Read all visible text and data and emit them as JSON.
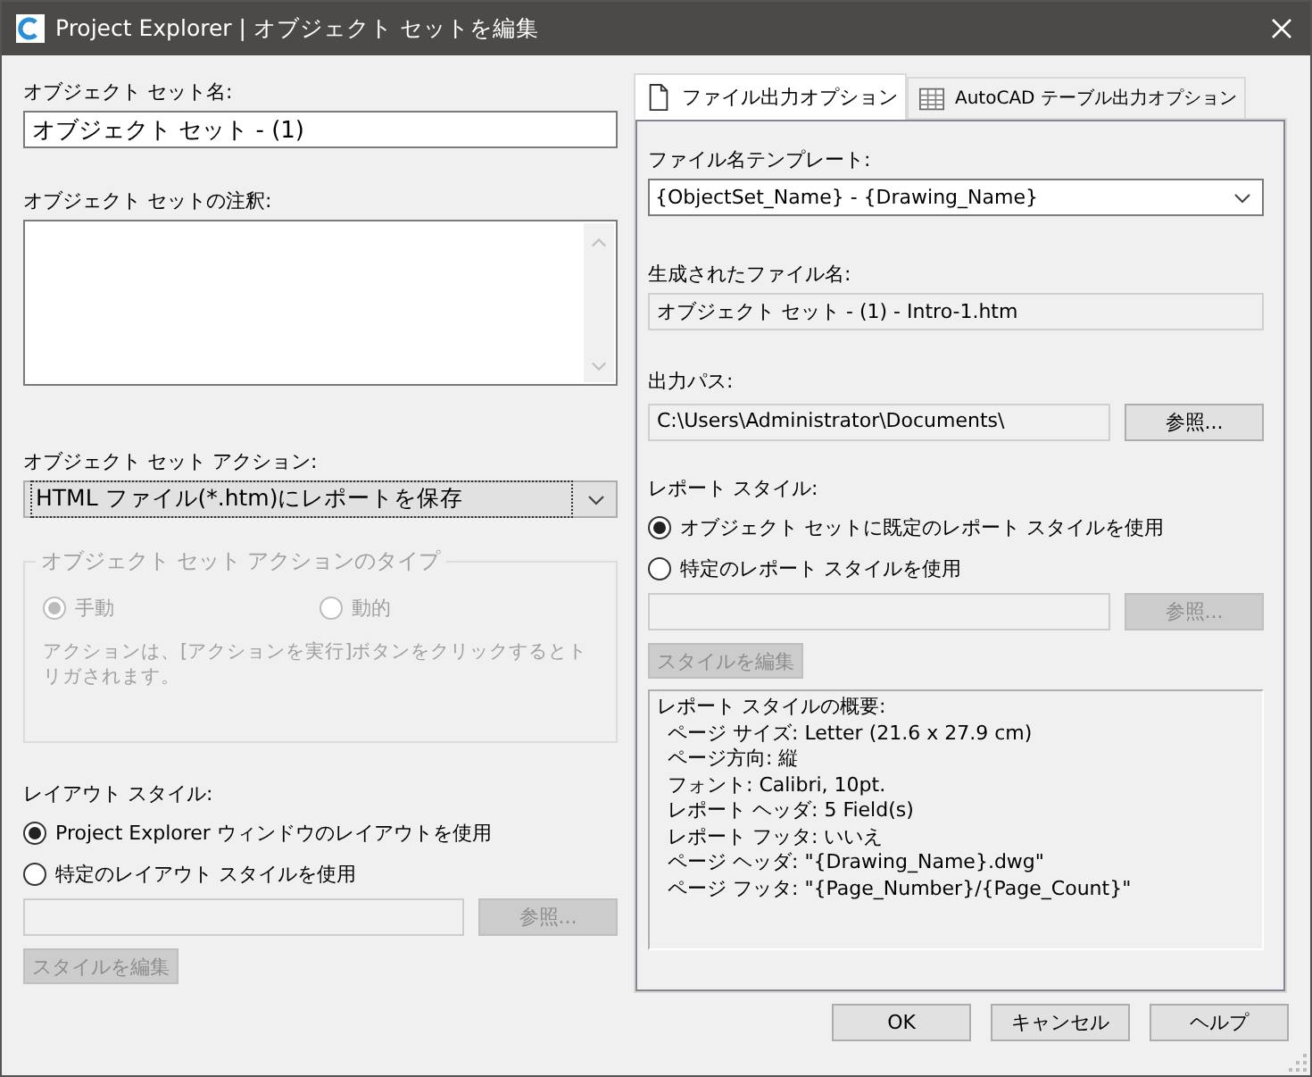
{
  "window": {
    "title": "Project Explorer | オブジェクト セットを編集"
  },
  "object_set": {
    "name": {
      "label": "オブジェクト セット名:",
      "value": "オブジェクト セット - (1)"
    },
    "note": {
      "label": "オブジェクト セットの注釈:"
    },
    "action": {
      "label": "オブジェクト セット アクション:",
      "value": "HTML ファイル(*.htm)にレポートを保存"
    },
    "action_type": {
      "legend": "オブジェクト セット アクションのタイプ",
      "disabled": true,
      "options": [
        {
          "label": "手動",
          "selected": true
        },
        {
          "label": "動的",
          "selected": false
        }
      ],
      "description": "アクションは、[アクションを実行]ボタンをクリックするとトリガされます。"
    },
    "layout_style": {
      "label": "レイアウト スタイル:",
      "options": [
        {
          "label": "Project Explorer ウィンドウのレイアウトを使用",
          "selected": true
        },
        {
          "label": "特定のレイアウト スタイルを使用",
          "selected": false
        }
      ],
      "path_disabled": true,
      "browse_button": {
        "label": "参照...",
        "disabled": true
      },
      "edit_button": {
        "label": "スタイルを編集",
        "disabled": true
      }
    }
  },
  "tabs": [
    {
      "label": "ファイル出力オプション",
      "selected": true
    },
    {
      "label": "AutoCAD テーブル出力オプション",
      "selected": false
    }
  ],
  "file_output": {
    "template": {
      "label": "ファイル名テンプレート:",
      "value": "{ObjectSet_Name} - {Drawing_Name}"
    },
    "generated": {
      "label": "生成されたファイル名:",
      "value": "オブジェクト セット - (1) - Intro-1.htm"
    },
    "output_path": {
      "label": "出力パス:",
      "value": "C:\\Users\\Administrator\\Documents\\",
      "browse_button": {
        "label": "参照...",
        "disabled": false
      }
    },
    "report_style": {
      "label": "レポート スタイル:",
      "options": [
        {
          "label": "オブジェクト セットに既定のレポート スタイルを使用",
          "selected": true
        },
        {
          "label": "特定のレポート スタイルを使用",
          "selected": false
        }
      ],
      "path_disabled": true,
      "browse_button": {
        "label": "参照...",
        "disabled": true
      },
      "edit_button": {
        "label": "スタイルを編集",
        "disabled": true
      }
    },
    "summary": {
      "title": "レポート スタイルの概要:",
      "lines": [
        "ページ サイズ: Letter (21.6 x 27.9 cm)",
        "ページ方向: 縦",
        "フォント: Calibri, 10pt.",
        "レポート ヘッダ: 5 Field(s)",
        "レポート フッタ: いいえ",
        "ページ ヘッダ: \"{Drawing_Name}.dwg\"",
        "ページ フッタ: \"{Page_Number}/{Page_Count}\""
      ]
    }
  },
  "buttons": [
    {
      "label": "OK"
    },
    {
      "label": "キャンセル"
    },
    {
      "label": "ヘルプ"
    }
  ]
}
